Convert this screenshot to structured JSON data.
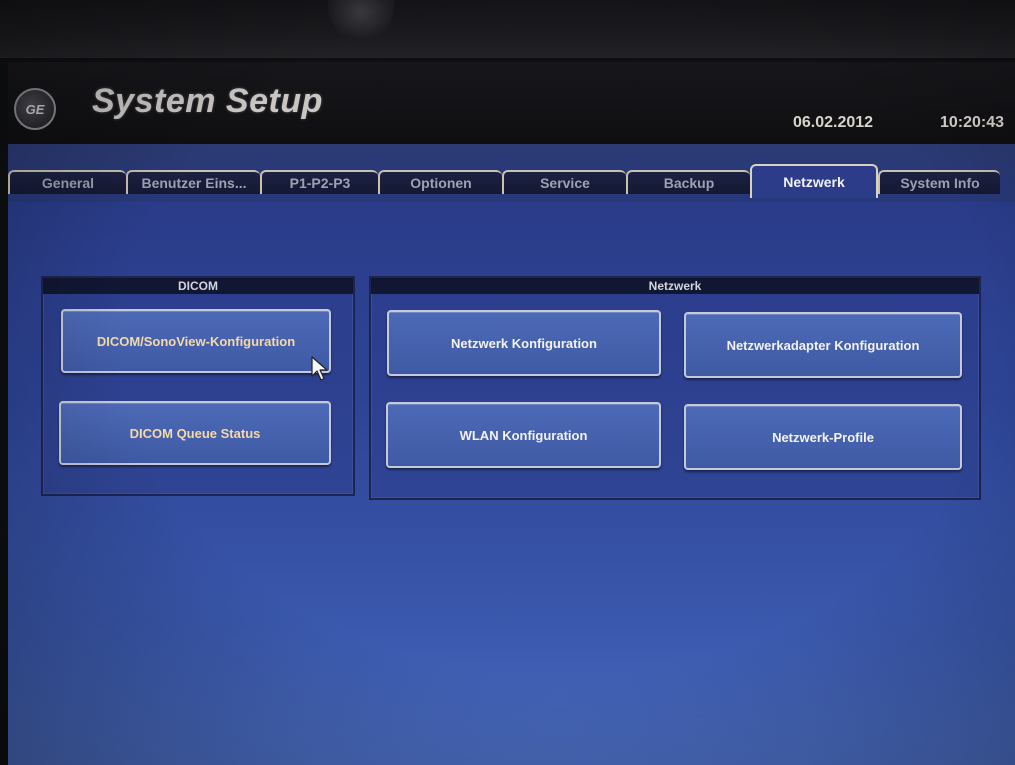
{
  "app": {
    "title": "System Setup",
    "logo_icon": "ge-logo-icon",
    "date": "06.02.2012",
    "time": "10:20:43"
  },
  "tabs": [
    {
      "label": "General",
      "active": false
    },
    {
      "label": "Benutzer Eins...",
      "active": false
    },
    {
      "label": "P1-P2-P3",
      "active": false
    },
    {
      "label": "Optionen",
      "active": false
    },
    {
      "label": "Service",
      "active": false
    },
    {
      "label": "Backup",
      "active": false
    },
    {
      "label": "Netzwerk",
      "active": true
    },
    {
      "label": "System Info",
      "active": false
    }
  ],
  "dicom_group": {
    "title": "DICOM",
    "buttons": [
      {
        "label": "DICOM/SonoView-Konfiguration"
      },
      {
        "label": "DICOM Queue Status"
      }
    ]
  },
  "network_group": {
    "title": "Netzwerk",
    "buttons": [
      {
        "label": "Netzwerk Konfiguration"
      },
      {
        "label": "Netzwerkadapter Konfiguration"
      },
      {
        "label": "WLAN Konfiguration"
      },
      {
        "label": "Netzwerk-Profile"
      }
    ]
  },
  "colors": {
    "background": "#2d4495",
    "tab_strip": "#2a3a78",
    "button": "#4d6ab6",
    "button_text": "#f4f2f2",
    "highlight_text": "#f5d9a8",
    "title_text": "#c9c6c4"
  },
  "cursor_icon": "mouse-pointer-icon"
}
